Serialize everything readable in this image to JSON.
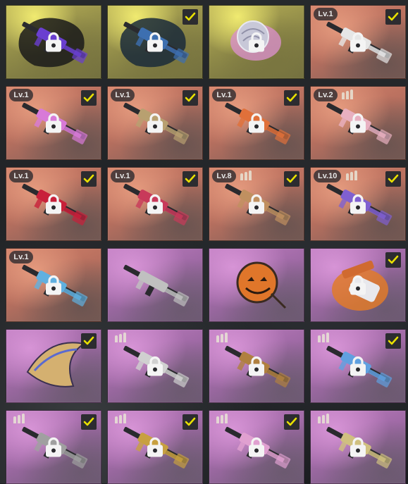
{
  "colors": {
    "yellow_tier": "#b9b156",
    "red_tier": "#c9786a",
    "purple_tier": "#b275b4",
    "check_box": "#2c2c30",
    "check_mark": "#e8e000",
    "lock": "#f4f4f4"
  },
  "items": [
    {
      "tier": "yellow",
      "level": "",
      "bullets": 0,
      "checked": false,
      "locked": true,
      "icon": "rifle-skin-icon"
    },
    {
      "tier": "yellow",
      "level": "",
      "bullets": 0,
      "checked": true,
      "locked": true,
      "icon": "rifle-skin-icon"
    },
    {
      "tier": "yellow",
      "level": "",
      "bullets": 0,
      "checked": false,
      "locked": true,
      "icon": "charm-icon"
    },
    {
      "tier": "red",
      "level": "Lv.1",
      "bullets": 0,
      "checked": true,
      "locked": true,
      "icon": "rifle-skin-icon"
    },
    {
      "tier": "red",
      "level": "Lv.1",
      "bullets": 0,
      "checked": true,
      "locked": true,
      "icon": "rifle-skin-icon"
    },
    {
      "tier": "red",
      "level": "Lv.1",
      "bullets": 0,
      "checked": true,
      "locked": true,
      "icon": "rifle-skin-icon"
    },
    {
      "tier": "red",
      "level": "Lv.1",
      "bullets": 0,
      "checked": true,
      "locked": true,
      "icon": "rifle-skin-icon"
    },
    {
      "tier": "red",
      "level": "Lv.2",
      "bullets": 3,
      "checked": false,
      "locked": true,
      "icon": "rifle-skin-icon"
    },
    {
      "tier": "red",
      "level": "Lv.1",
      "bullets": 0,
      "checked": true,
      "locked": true,
      "icon": "rifle-skin-icon"
    },
    {
      "tier": "red",
      "level": "Lv.1",
      "bullets": 0,
      "checked": true,
      "locked": true,
      "icon": "rifle-skin-icon"
    },
    {
      "tier": "red",
      "level": "Lv.8",
      "bullets": 3,
      "checked": true,
      "locked": true,
      "icon": "shotgun-skin-icon"
    },
    {
      "tier": "red",
      "level": "Lv.10",
      "bullets": 3,
      "checked": true,
      "locked": true,
      "icon": "rifle-skin-icon"
    },
    {
      "tier": "red",
      "level": "Lv.1",
      "bullets": 0,
      "checked": false,
      "locked": true,
      "icon": "rifle-skin-icon"
    },
    {
      "tier": "purple",
      "level": "",
      "bullets": 0,
      "checked": false,
      "locked": false,
      "icon": "sniper-skin-icon"
    },
    {
      "tier": "purple",
      "level": "",
      "bullets": 0,
      "checked": false,
      "locked": false,
      "icon": "pumpkin-charm-icon"
    },
    {
      "tier": "purple",
      "level": "",
      "bullets": 0,
      "checked": true,
      "locked": true,
      "icon": "sticker-icon"
    },
    {
      "tier": "purple",
      "level": "",
      "bullets": 0,
      "checked": true,
      "locked": false,
      "icon": "wing-charm-icon"
    },
    {
      "tier": "purple",
      "level": "",
      "bullets": 3,
      "checked": false,
      "locked": true,
      "icon": "rifle-skin-icon"
    },
    {
      "tier": "purple",
      "level": "",
      "bullets": 3,
      "checked": false,
      "locked": true,
      "icon": "rifle-skin-icon"
    },
    {
      "tier": "purple",
      "level": "",
      "bullets": 3,
      "checked": true,
      "locked": true,
      "icon": "rifle-skin-icon"
    },
    {
      "tier": "purple",
      "level": "",
      "bullets": 3,
      "checked": true,
      "locked": true,
      "icon": "rifle-skin-icon"
    },
    {
      "tier": "purple",
      "level": "",
      "bullets": 3,
      "checked": true,
      "locked": true,
      "icon": "rifle-skin-icon"
    },
    {
      "tier": "purple",
      "level": "",
      "bullets": 3,
      "checked": true,
      "locked": true,
      "icon": "rifle-skin-icon"
    },
    {
      "tier": "purple",
      "level": "",
      "bullets": 3,
      "checked": false,
      "locked": true,
      "icon": "rifle-skin-icon"
    }
  ]
}
